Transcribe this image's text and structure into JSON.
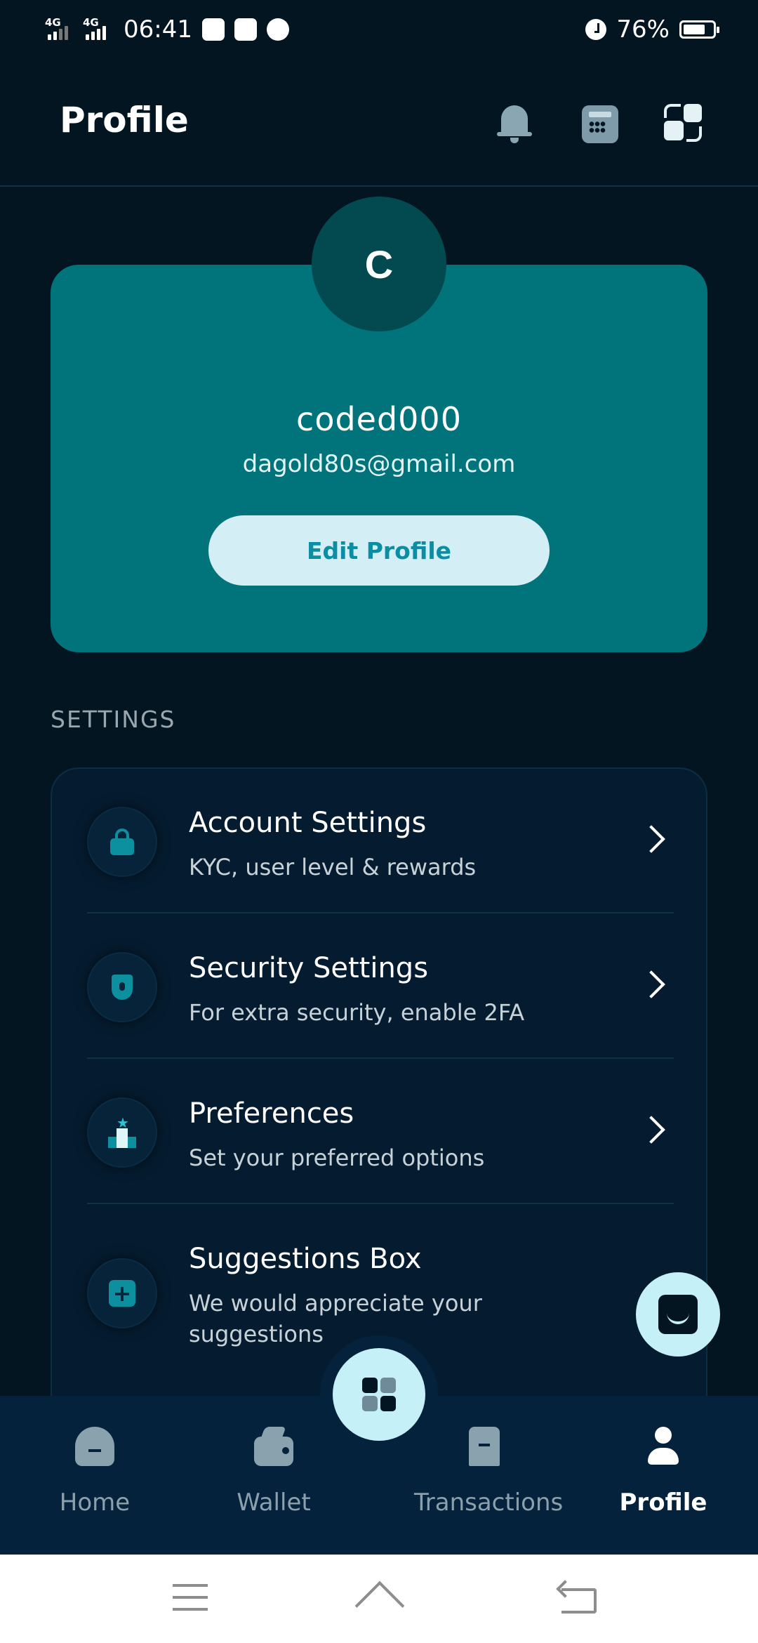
{
  "status_bar": {
    "network1": "4G",
    "network2": "4G",
    "time": "06:41",
    "battery_percent": "76%",
    "battery_level": 0.76
  },
  "header": {
    "title": "Profile",
    "icons": [
      "bell-icon",
      "calculator-icon",
      "convert-icon"
    ]
  },
  "profile": {
    "avatar_letter": "C",
    "username": "coded000",
    "email": "dagold80s@gmail.com",
    "edit_label": "Edit Profile",
    "card_color": "#00747a"
  },
  "settings": {
    "section_label": "SETTINGS",
    "items": [
      {
        "title": "Account Settings",
        "subtitle": "KYC, user level & rewards",
        "icon": "lock-icon"
      },
      {
        "title": "Security Settings",
        "subtitle": "For extra security, enable 2FA",
        "icon": "shield-icon"
      },
      {
        "title": "Preferences",
        "subtitle": "Set your preferred options",
        "icon": "podium-icon"
      },
      {
        "title": "Suggestions Box",
        "subtitle": "We would appreciate your suggestions",
        "icon": "plus-icon"
      }
    ]
  },
  "bottom_nav": {
    "items": [
      {
        "label": "Home",
        "icon": "home-icon",
        "active": false
      },
      {
        "label": "Wallet",
        "icon": "wallet-icon",
        "active": false
      },
      {
        "label": "Transactions",
        "icon": "receipt-icon",
        "active": false
      },
      {
        "label": "Profile",
        "icon": "user-icon",
        "active": true
      }
    ],
    "center_icon": "grid-icon"
  },
  "colors": {
    "background": "#031521",
    "accent": "#c6f0f7",
    "teal": "#00747a",
    "nav_bg": "#04223b"
  }
}
